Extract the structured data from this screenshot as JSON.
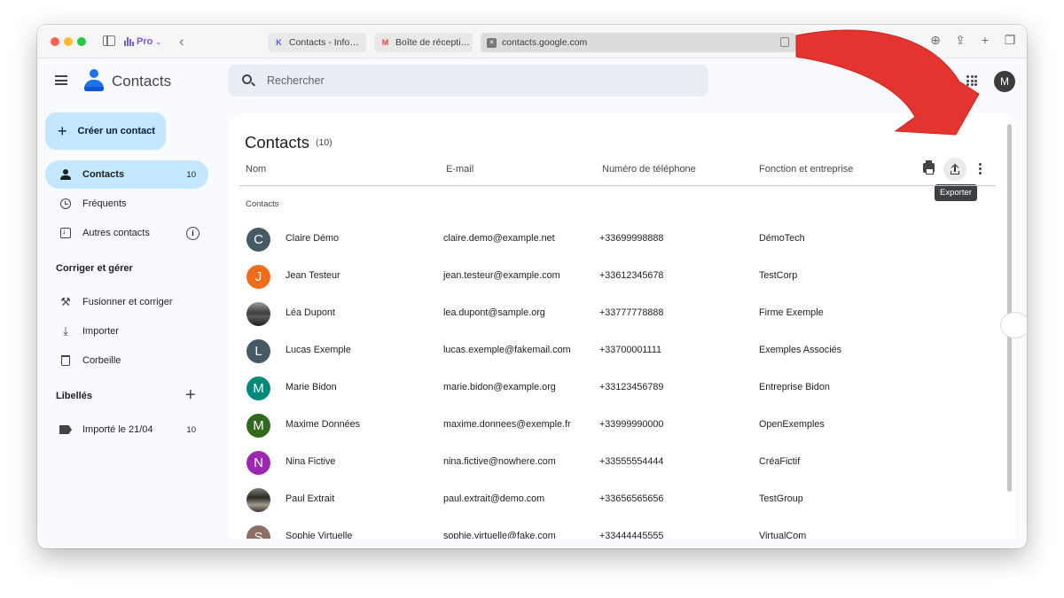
{
  "browser": {
    "profile_label": "Pro",
    "tabs": [
      {
        "label": "Contacts - Info…",
        "favicon": "k-logo-icon"
      },
      {
        "label": "Boîte de récepti…",
        "favicon": "gmail-icon"
      },
      {
        "label": "contacts.google.com",
        "favicon": "x-site-icon",
        "active": true
      }
    ]
  },
  "app": {
    "title": "Contacts",
    "search_placeholder": "Rechercher",
    "account_initial": "M"
  },
  "sidebar": {
    "create_label": "Créer un contact",
    "items": [
      {
        "label": "Contacts",
        "count": "10",
        "icon": "person-icon",
        "active": true
      },
      {
        "label": "Fréquents",
        "icon": "history-icon"
      },
      {
        "label": "Autres contacts",
        "icon": "download-box-icon"
      }
    ],
    "manage_heading": "Corriger et gérer",
    "manage_items": [
      {
        "label": "Fusionner et corriger",
        "icon": "tools-icon"
      },
      {
        "label": "Importer",
        "icon": "import-icon"
      },
      {
        "label": "Corbeille",
        "icon": "trash-icon"
      }
    ],
    "labels_heading": "Libellés",
    "labels": [
      {
        "label": "Importé le 21/04",
        "count": "10",
        "icon": "label-icon"
      }
    ]
  },
  "main": {
    "title": "Contacts",
    "count": "(10)",
    "columns": [
      "Nom",
      "E-mail",
      "Numéro de téléphone",
      "Fonction et entreprise"
    ],
    "export_tooltip": "Exporter",
    "group_label": "Contacts",
    "rows": [
      {
        "initial": "C",
        "color": "#455a64",
        "name": "Claire Démo",
        "email": "claire.demo@example.net",
        "phone": "+33699998888",
        "company": "DémoTech"
      },
      {
        "initial": "J",
        "color": "#ef6c1a",
        "name": "Jean Testeur",
        "email": "jean.testeur@example.com",
        "phone": "+33612345678",
        "company": "TestCorp"
      },
      {
        "initial": "",
        "color": "photo",
        "name": "Léa Dupont",
        "email": "lea.dupont@sample.org",
        "phone": "+33777778888",
        "company": "Firme Exemple"
      },
      {
        "initial": "L",
        "color": "#455a64",
        "name": "Lucas Exemple",
        "email": "lucas.exemple@fakemail.com",
        "phone": "+33700001111",
        "company": "Exemples Associés"
      },
      {
        "initial": "M",
        "color": "#00897b",
        "name": "Marie Bidon",
        "email": "marie.bidon@example.org",
        "phone": "+33123456789",
        "company": "Entreprise Bidon"
      },
      {
        "initial": "M",
        "color": "#33691e",
        "name": "Maxime Données",
        "email": "maxime.donnees@exemple.fr",
        "phone": "+33999990000",
        "company": "OpenExemples"
      },
      {
        "initial": "N",
        "color": "#9c27b0",
        "name": "Nina Fictive",
        "email": "nina.fictive@nowhere.com",
        "phone": "+33555554444",
        "company": "CréaFictif"
      },
      {
        "initial": "",
        "color": "photo2",
        "name": "Paul Extrait",
        "email": "paul.extrait@demo.com",
        "phone": "+33656565656",
        "company": "TestGroup"
      },
      {
        "initial": "S",
        "color": "#8d6e63",
        "name": "Sophie Virtuelle",
        "email": "sophie.virtuelle@fake.com",
        "phone": "+33444445555",
        "company": "VirtualCom"
      }
    ]
  },
  "annotation_color": "#e3342f"
}
